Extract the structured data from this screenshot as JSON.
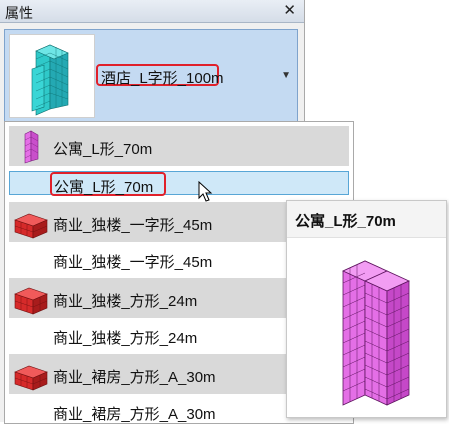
{
  "panel": {
    "title": "属性",
    "close_glyph": "✕"
  },
  "type_selector": {
    "current_type": "酒店_L字形_100m",
    "thumbnail_icon": "building-thumbnail-cyan-icon",
    "dropdown_glyph": "▼"
  },
  "dropdown": {
    "groups": [
      {
        "header": "公寓_L形_70m",
        "icon": "building-magenta-icon",
        "item": "公寓_L形_70m",
        "item_selected": true
      },
      {
        "header": "商业_独楼_一字形_45m",
        "icon": "building-red-icon",
        "item": "商业_独楼_一字形_45m",
        "item_selected": false
      },
      {
        "header": "商业_独楼_方形_24m",
        "icon": "building-red-icon",
        "item": "商业_独楼_方形_24m",
        "item_selected": false
      },
      {
        "header": "商业_裙房_方形_A_30m",
        "icon": "building-red-icon",
        "item": "商业_裙房_方形_A_30m",
        "item_selected": false
      }
    ]
  },
  "tooltip": {
    "title": "公寓_L形_70m",
    "preview_icon": "building-preview-magenta-icon"
  },
  "colors": {
    "highlight_red": "#e0202a",
    "selected_bg": "#cfe8f8",
    "hotel_cyan": "#2ed3d3",
    "apartment_magenta": "#e46fe6",
    "commercial_red": "#d62a2a"
  }
}
